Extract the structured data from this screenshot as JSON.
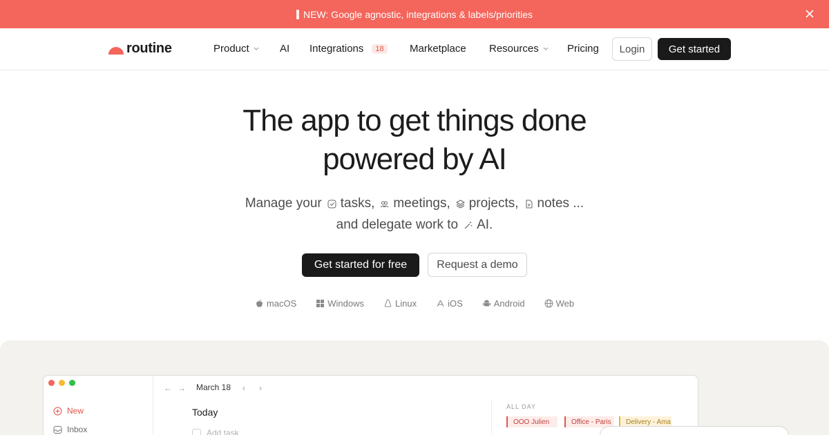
{
  "banner": {
    "text": "NEW: Google agnostic, integrations & labels/priorities"
  },
  "nav": {
    "logo": "routine",
    "items": [
      {
        "label": "Product"
      },
      {
        "label": "AI"
      },
      {
        "label": "Integrations",
        "badge": "18"
      },
      {
        "label": "Marketplace"
      },
      {
        "label": "Resources"
      },
      {
        "label": "Pricing"
      }
    ],
    "login": "Login",
    "get_started": "Get started"
  },
  "hero": {
    "line1": "The app to get things done",
    "line2": "powered by AI",
    "sub": {
      "manage": "Manage your",
      "tasks": "tasks,",
      "meetings": "meetings,",
      "projects": "projects,",
      "notes": "notes ...",
      "delegate": "and delegate work to",
      "ai": "AI."
    },
    "cta_primary": "Get started for free",
    "cta_secondary": "Request a demo"
  },
  "platforms": [
    "macOS",
    "Windows",
    "Linux",
    "iOS",
    "Android",
    "Web"
  ],
  "preview": {
    "date": "March 18",
    "sidebar": {
      "new": "New",
      "inbox": "Inbox"
    },
    "today": "Today",
    "add_task": "Add task",
    "all_day": "ALL DAY",
    "events": [
      "OOO Julien",
      "Office - Paris",
      "Delivery - Ama"
    ]
  },
  "colors": {
    "accent": "#f4655b",
    "dark": "#1a1a1a"
  }
}
